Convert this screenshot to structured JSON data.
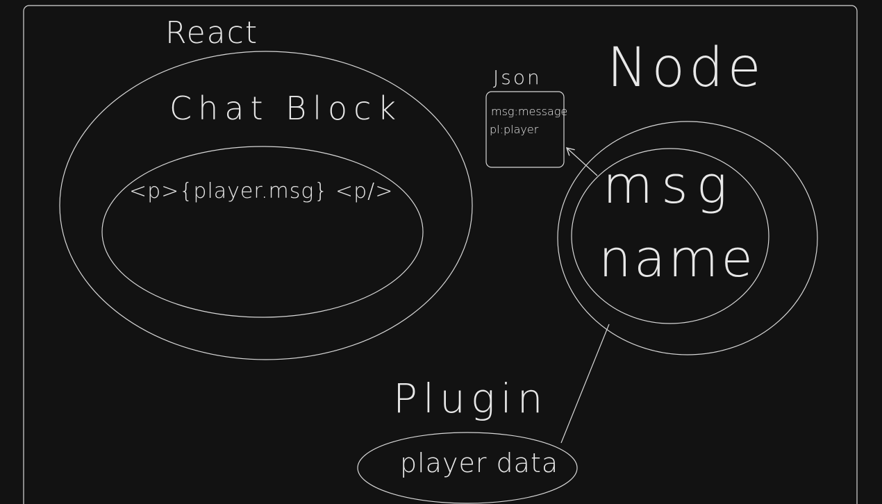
{
  "diagram": {
    "react": {
      "label": "React",
      "component": "Chat Block",
      "code": "<p>{player.msg} <p/>"
    },
    "json": {
      "label": "Json",
      "lines": [
        "msg:message",
        "pl:player"
      ]
    },
    "node": {
      "label": "Node",
      "field_1": "msg",
      "field_2": "name"
    },
    "plugin": {
      "label": "Plugin",
      "component": "player data"
    }
  }
}
